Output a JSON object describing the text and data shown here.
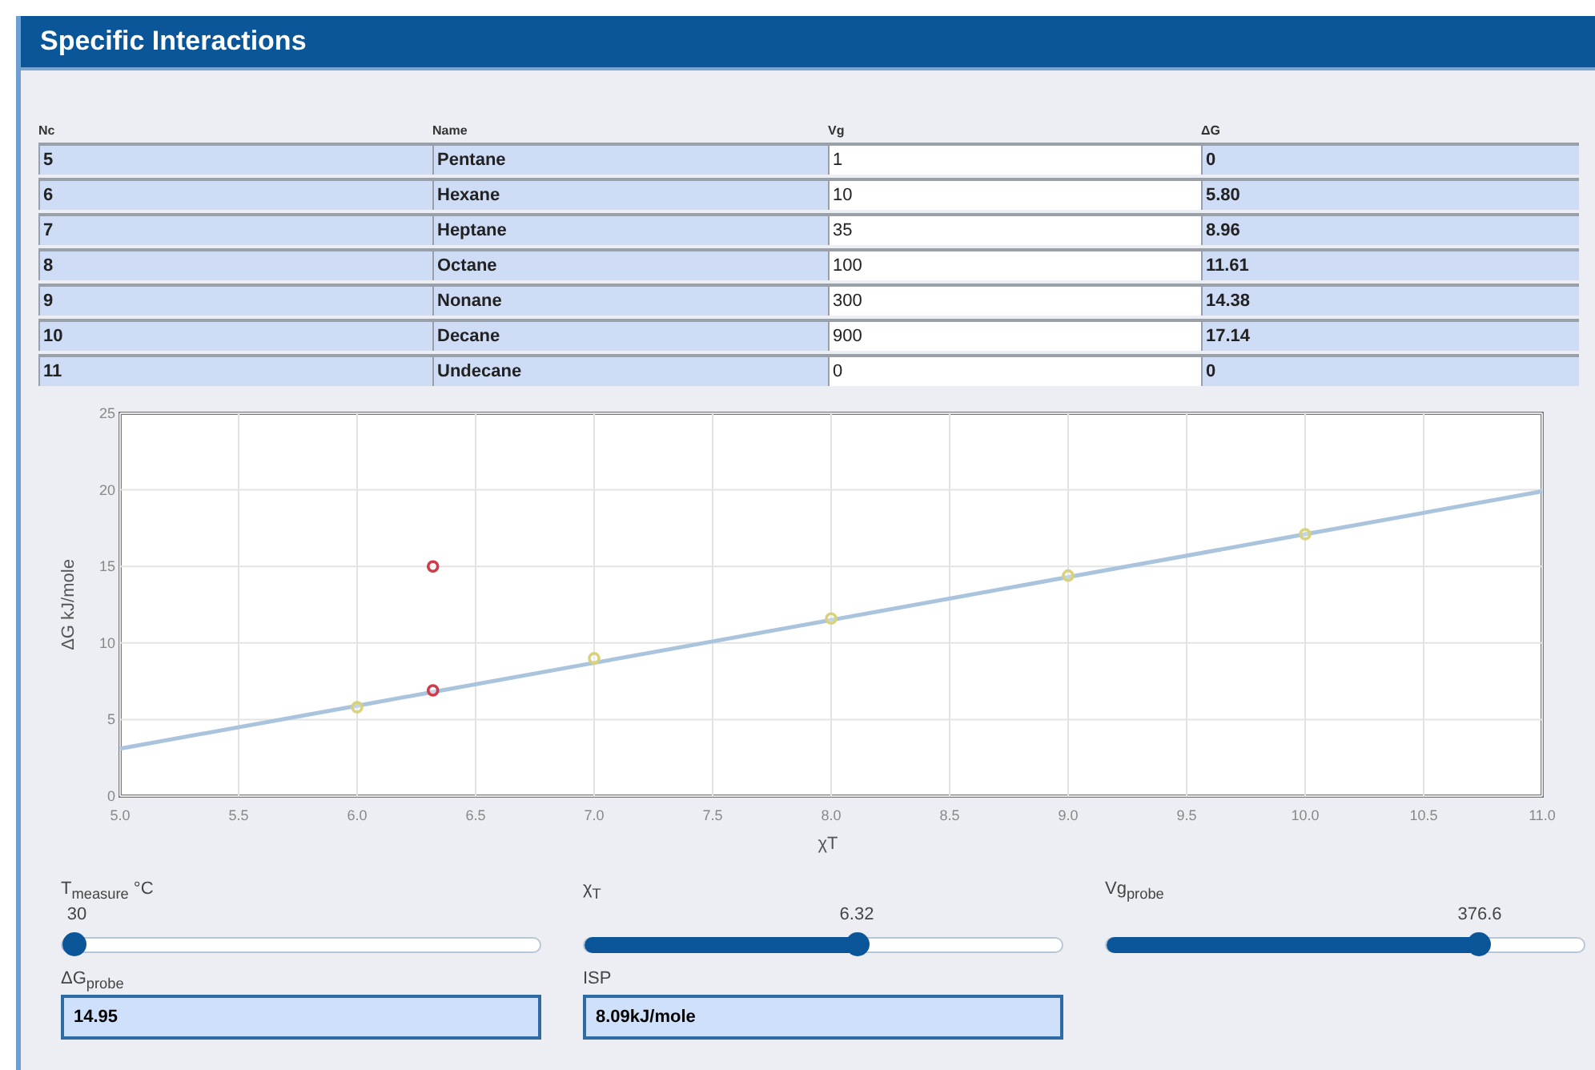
{
  "panel": {
    "title": "Specific Interactions"
  },
  "table": {
    "columns": [
      "Nc",
      "Name",
      "Vg",
      "ΔG"
    ],
    "rows": [
      [
        "5",
        "Pentane",
        "1",
        "0"
      ],
      [
        "6",
        "Hexane",
        "10",
        "5.80"
      ],
      [
        "7",
        "Heptane",
        "35",
        "8.96"
      ],
      [
        "8",
        "Octane",
        "100",
        "11.61"
      ],
      [
        "9",
        "Nonane",
        "300",
        "14.38"
      ],
      [
        "10",
        "Decane",
        "900",
        "17.14"
      ],
      [
        "11",
        "Undecane",
        "0",
        "0"
      ]
    ]
  },
  "chart": {
    "chart_data": {
      "type": "scatter",
      "xlabel": "χT",
      "ylabel": "ΔG kJ/mole",
      "x": [
        5,
        6,
        6.32,
        7,
        8,
        9,
        10,
        11
      ],
      "xlim": [
        5,
        11
      ],
      "grid": true,
      "ylim": [
        0,
        25
      ],
      "xticks": [
        {
          "value": 5,
          "label": "5.0"
        },
        5.5,
        {
          "value": 6,
          "label": "6.0"
        },
        6.5,
        {
          "value": 7,
          "label": "7.0"
        },
        7.5,
        {
          "value": 8,
          "label": "8.0"
        },
        8.5,
        {
          "value": 9,
          "label": "9.0"
        },
        9.5,
        {
          "value": 10,
          "label": "10.0"
        },
        10.5,
        {
          "value": 11,
          "label": "11.0"
        }
      ],
      "yticks": [
        0,
        5,
        10,
        15,
        20,
        25
      ],
      "series": [
        {
          "type": "line",
          "color": "#a9c4dc",
          "values": [
            3.1,
            5.9,
            6.8,
            8.7,
            11.5,
            14.3,
            17.1,
            19.9
          ]
        },
        {
          "color": "#d8d27a",
          "values": [
            null,
            5.8,
            null,
            9,
            11.6,
            14.4,
            17.1,
            null
          ]
        },
        {
          "color": "#d23a4a",
          "values": [
            null,
            null,
            15,
            null,
            null,
            null,
            null,
            null
          ]
        },
        {
          "color": "#d23a4a",
          "values": [
            null,
            null,
            6.9,
            null,
            null,
            null,
            null,
            null
          ]
        }
      ]
    }
  },
  "sliders": [
    {
      "label": "T$_{measure}$ °C",
      "value": "30",
      "level": 0.0
    },
    {
      "label": "χ$_{T}$",
      "value": "6.32",
      "level": 0.57
    },
    {
      "label": "Vg$_{probe}$",
      "value": "376.6",
      "level": 0.78
    }
  ],
  "outputs": [
    {
      "label": "ΔG$_{probe}$",
      "value": "14.95"
    },
    {
      "label": "ISP",
      "value": "8.09kJ/mole"
    }
  ]
}
